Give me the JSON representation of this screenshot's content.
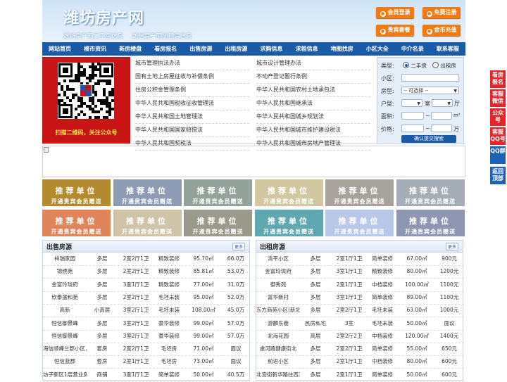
{
  "header": {
    "logo": "潍坊房产网",
    "subtitles": [
      "潍坊房产网二手房信息",
      "潍坊房产网出租房信息"
    ],
    "buttons": [
      {
        "label": "会员登录",
        "icon": "user-icon"
      },
      {
        "label": "免费注册",
        "icon": "register-icon"
      },
      {
        "label": "贵宾套餐",
        "icon": "vip-icon"
      },
      {
        "label": "金币充值",
        "icon": "coin-icon"
      }
    ]
  },
  "nav": [
    "网站首页",
    "楼市资讯",
    "新房楼盘",
    "看房报名",
    "出售房源",
    "出租房源",
    "求购信息",
    "求租信息",
    "地图找房",
    "小区大全",
    "中介名录",
    "联系客服"
  ],
  "qr_caption": "扫描二维码，关注公众号",
  "laws_left": [
    "城市管理执法办法",
    "国有土地上房屋征收与补偿条例",
    "住房公积金管理条例",
    "中华人民共和国税收征收管理法",
    "中华人民共和国土地管理法",
    "中华人民共和国国家赔偿法",
    "中华人民共和国契税法"
  ],
  "laws_right": [
    "城市设计管理办法",
    "不动产登记暂行条例",
    "中华人民共和国农村土地承包法",
    "中华人民共和国继承法",
    "中华人民共和国城乡规划法",
    "中华人民共和国城市维护建设税法",
    "中华人民共和国城市房地产管理法"
  ],
  "search": {
    "type_label": "类型:",
    "opt_sale": "二手房",
    "opt_rent": "出租房",
    "community_label": "小区:",
    "housetype_label": "房型:",
    "housetype_value": "-- 可选择 --",
    "layout_label": "户型:",
    "room_unit": "室",
    "hall_unit": "厅",
    "area_label": "面积:",
    "area_sep": "~",
    "area_unit": "m²",
    "price_label": "价格:",
    "price_sep": "~",
    "price_unit": "万",
    "submit": "确认提交搜索"
  },
  "tiles": {
    "line1": "推荐单位",
    "line2": "开通贵宾会员赠送",
    "colors": [
      "#b38a2e",
      "#8e9bb5",
      "#93a39c",
      "#d3c7a2",
      "#a8a39a",
      "#a5adb7",
      "#e0845c",
      "#cfc4a8",
      "#9a9a8c",
      "#5fa8b0",
      "#b9c8e8",
      "#8f96b2"
    ]
  },
  "sale": {
    "title": "出售房源",
    "more": "更多",
    "rows": [
      [
        "祥瑞家园",
        "多层",
        "2室2厅1卫",
        "精致装修",
        "95.70㎡",
        "66.0万"
      ],
      [
        "锦绣苑",
        "多层",
        "2室2厅1卫",
        "精致装修",
        "85.81㎡",
        "53.0万"
      ],
      [
        "金富玲珑府",
        "多层",
        "3室1厅1卫",
        "精致装修",
        "77.00㎡",
        "31.0万"
      ],
      [
        "欣泰盛和苑",
        "多层",
        "2室2厅1卫",
        "毛坯未装",
        "95.00㎡",
        "52.0万"
      ],
      [
        "高新",
        "小高层",
        "3室2厅1卫",
        "毛坯未装",
        "108.00㎡",
        "45.0万"
      ],
      [
        "恒信御景峰",
        "多层",
        "3室2厅1卫",
        "豪华装修",
        "99.00㎡",
        "57.0万"
      ],
      [
        "恒信御景峰",
        "多层",
        "3室2厅1卫",
        "豪华装修",
        "99.00㎡",
        "57.0万"
      ],
      [
        "海信顺峰兰郡小区，新",
        "套房",
        "2室2厅1卫",
        "毛坯房",
        "71.00㎡",
        "面议"
      ],
      [
        "恒信蓝郡",
        "套房",
        "2室1厅1卫",
        "毛坯房",
        "73.00㎡",
        "面议"
      ],
      [
        "坊子新区1层营业房",
        "商铺",
        "3室1厅1卫",
        "简单装修",
        "50.00㎡",
        "40.5万"
      ]
    ]
  },
  "rent": {
    "title": "出租房源",
    "more": "更多",
    "rows": [
      [
        "清平小区",
        "多层",
        "2室1厅1卫",
        "简单装修",
        "67.00㎡",
        "900元"
      ],
      [
        "金富玲珑府",
        "多层",
        "3室1厅1卫",
        "精致装修",
        "80.00㎡",
        "1200元"
      ],
      [
        "御秀苑",
        "多层",
        "2室1厅1卫",
        "中档装修",
        "100.00㎡",
        "1100元"
      ],
      [
        "富华新村",
        "多层",
        "3室1厅1卫",
        "简单装修",
        "89.00㎡",
        "1100元"
      ],
      [
        "东方商苑小区(新北里)",
        "多层",
        "2室2厅1卫",
        "毛坯未装",
        "63.00㎡",
        "1000元"
      ],
      [
        "游麟东巷",
        "民房私宅",
        "3室",
        "毛坯未装",
        "50.00㎡",
        "面议"
      ],
      [
        "北海花园",
        "高层",
        "2室2厅2卫",
        "中档装修",
        "120.00㎡",
        "1400元"
      ],
      [
        "虞河路健康街北",
        "多层",
        "2室2厅1卫",
        "简单装修",
        "55.00㎡",
        "650元"
      ],
      [
        "前进小区",
        "多层",
        "2室1厅1卫",
        "中档装修",
        "80.00㎡",
        "600元"
      ],
      [
        "北宫街新华路往西30",
        "多层",
        "2室1厅1卫",
        "简单装修",
        "50.00㎡",
        "600元"
      ]
    ]
  },
  "sidebar": [
    {
      "label": "看房报名",
      "color": "#e4262b"
    },
    {
      "label": "客服微信",
      "color": "#e4262b"
    },
    {
      "label": "公众号",
      "color": "#e4262b"
    },
    {
      "label": "客服QQ号",
      "color": "#e4262b"
    },
    {
      "label": "QQ群",
      "color": "#1e62b5"
    },
    {
      "label": "返回顶部",
      "color": "#1e62b5"
    }
  ]
}
